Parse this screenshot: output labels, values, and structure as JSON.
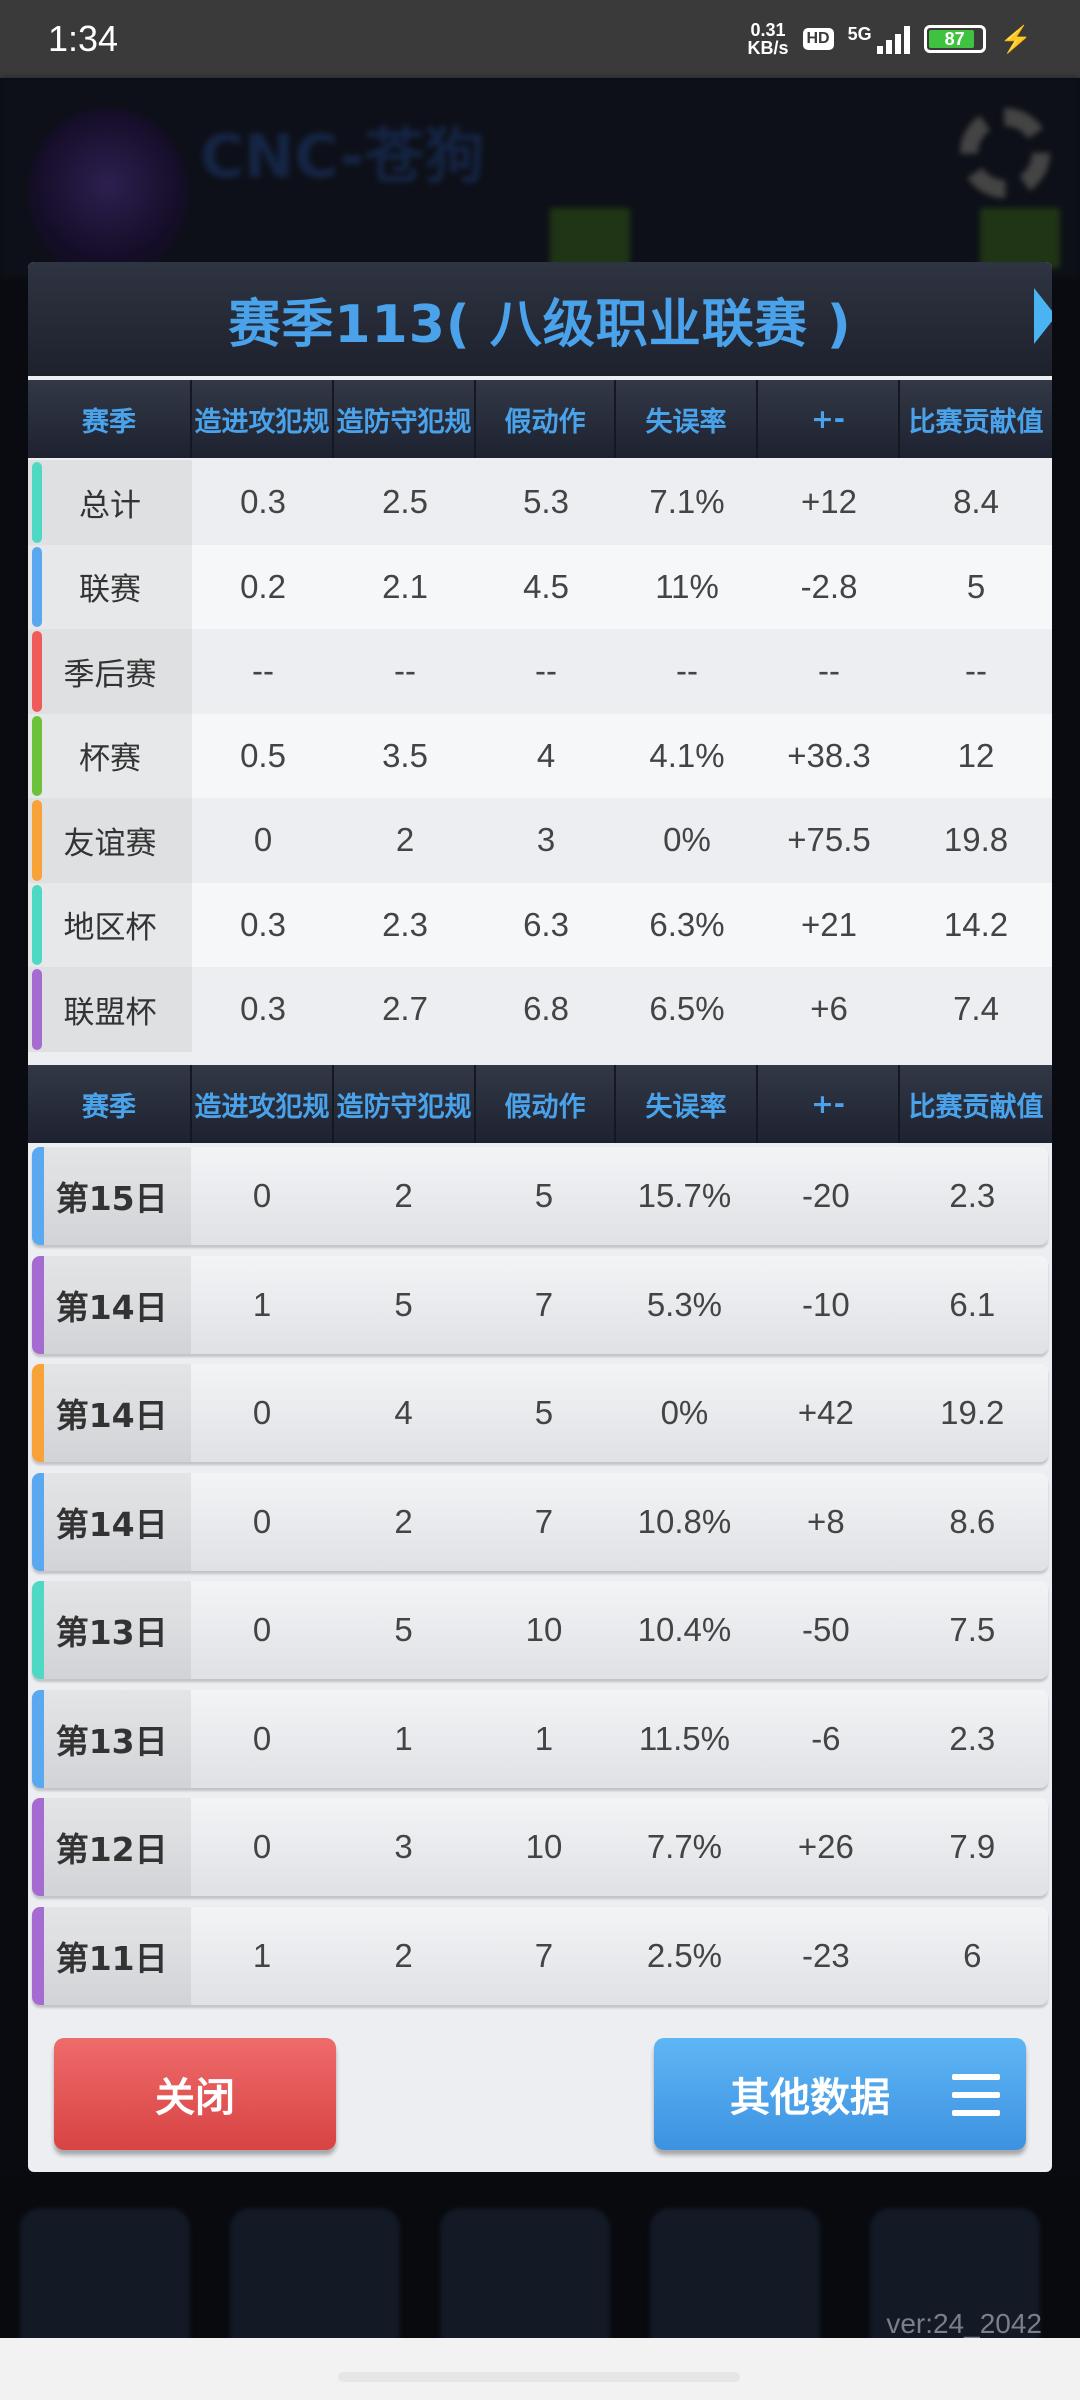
{
  "status_bar": {
    "time": "1:34",
    "net_speed_value": "0.31",
    "net_speed_unit": "KB/s",
    "hd": "HD",
    "signal": "5G",
    "battery": "87"
  },
  "background": {
    "team_name": "CNC-苍狗",
    "version": "ver:24_2042"
  },
  "dialog": {
    "title": "赛季113( 八级职业联赛 )",
    "columns": [
      "赛季",
      "造进攻犯规",
      "造防守犯规",
      "假动作",
      "失误率",
      "+-",
      "比赛贡献值"
    ],
    "summary_rows": [
      {
        "label": "总计",
        "accent": "#4fd8c4",
        "values": [
          "0.3",
          "2.5",
          "5.3",
          "7.1%",
          "+12",
          "8.4"
        ]
      },
      {
        "label": "联赛",
        "accent": "#5aa8f0",
        "values": [
          "0.2",
          "2.1",
          "4.5",
          "11%",
          "-2.8",
          "5"
        ]
      },
      {
        "label": "季后赛",
        "accent": "#ef5b5b",
        "values": [
          "--",
          "--",
          "--",
          "--",
          "--",
          "--"
        ]
      },
      {
        "label": "杯赛",
        "accent": "#6cc23a",
        "values": [
          "0.5",
          "3.5",
          "4",
          "4.1%",
          "+38.3",
          "12"
        ]
      },
      {
        "label": "友谊赛",
        "accent": "#f7a33a",
        "values": [
          "0",
          "2",
          "3",
          "0%",
          "+75.5",
          "19.8"
        ]
      },
      {
        "label": "地区杯",
        "accent": "#4fd8c4",
        "values": [
          "0.3",
          "2.3",
          "6.3",
          "6.3%",
          "+21",
          "14.2"
        ]
      },
      {
        "label": "联盟杯",
        "accent": "#a56bd0",
        "values": [
          "0.3",
          "2.7",
          "6.8",
          "6.5%",
          "+6",
          "7.4"
        ]
      }
    ],
    "daily_rows": [
      {
        "label": "第15日",
        "accent": "#5aa8f0",
        "values": [
          "0",
          "2",
          "5",
          "15.7%",
          "-20",
          "2.3"
        ]
      },
      {
        "label": "第14日",
        "accent": "#a56bd0",
        "values": [
          "1",
          "5",
          "7",
          "5.3%",
          "-10",
          "6.1"
        ]
      },
      {
        "label": "第14日",
        "accent": "#f7a33a",
        "values": [
          "0",
          "4",
          "5",
          "0%",
          "+42",
          "19.2"
        ]
      },
      {
        "label": "第14日",
        "accent": "#5aa8f0",
        "values": [
          "0",
          "2",
          "7",
          "10.8%",
          "+8",
          "8.6"
        ]
      },
      {
        "label": "第13日",
        "accent": "#4fd8c4",
        "values": [
          "0",
          "5",
          "10",
          "10.4%",
          "-50",
          "7.5"
        ]
      },
      {
        "label": "第13日",
        "accent": "#5aa8f0",
        "values": [
          "0",
          "1",
          "1",
          "11.5%",
          "-6",
          "2.3"
        ]
      },
      {
        "label": "第12日",
        "accent": "#a56bd0",
        "values": [
          "0",
          "3",
          "10",
          "7.7%",
          "+26",
          "7.9"
        ]
      },
      {
        "label": "第11日",
        "accent": "#a56bd0",
        "values": [
          "1",
          "2",
          "7",
          "2.5%",
          "-23",
          "6"
        ]
      }
    ],
    "close_button": "关闭",
    "other_button": "其他数据"
  },
  "colors": {
    "header_text": "#4aa3ea",
    "close_button": "#e05050",
    "other_button": "#4aa3ea"
  }
}
